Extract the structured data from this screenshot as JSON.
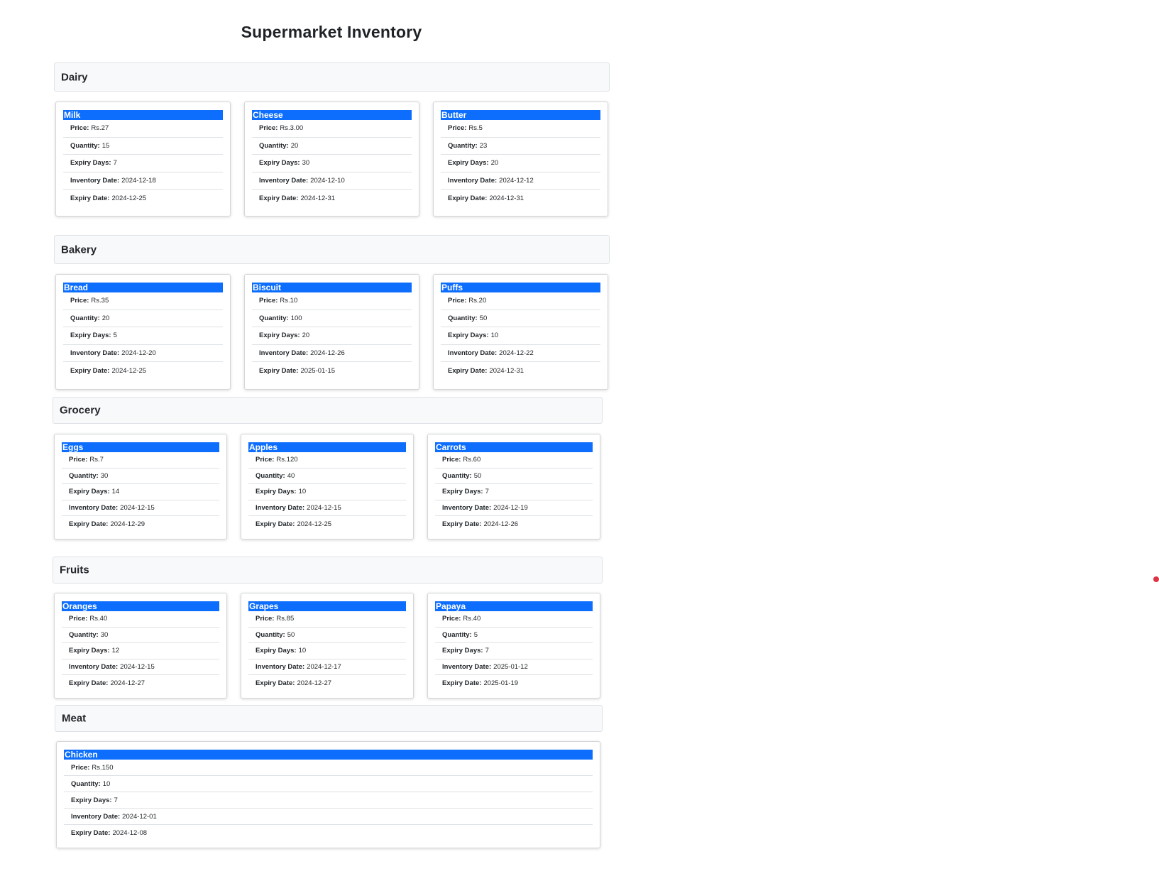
{
  "page": {
    "title": "Supermarket Inventory"
  },
  "fields": {
    "price": "Price:",
    "quantity": "Quantity:",
    "expiry_days": "Expiry Days:",
    "inventory_date": "Inventory Date:",
    "expiry_date": "Expiry Date:"
  },
  "categories": [
    {
      "name": "Dairy",
      "products": [
        {
          "name": "Milk",
          "price": "Rs.27",
          "quantity": "15",
          "expiry_days": "7",
          "inventory_date": "2024-12-18",
          "expiry_date": "2024-12-25"
        },
        {
          "name": "Cheese",
          "price": "Rs.3.00",
          "quantity": "20",
          "expiry_days": "30",
          "inventory_date": "2024-12-10",
          "expiry_date": "2024-12-31"
        },
        {
          "name": "Butter",
          "price": "Rs.5",
          "quantity": "23",
          "expiry_days": "20",
          "inventory_date": "2024-12-12",
          "expiry_date": "2024-12-31"
        }
      ]
    },
    {
      "name": "Bakery",
      "products": [
        {
          "name": "Bread",
          "price": "Rs.35",
          "quantity": "20",
          "expiry_days": "5",
          "inventory_date": "2024-12-20",
          "expiry_date": "2024-12-25"
        },
        {
          "name": "Biscuit",
          "price": "Rs.10",
          "quantity": "100",
          "expiry_days": "20",
          "inventory_date": "2024-12-26",
          "expiry_date": "2025-01-15"
        },
        {
          "name": "Puffs",
          "price": "Rs.20",
          "quantity": "50",
          "expiry_days": "10",
          "inventory_date": "2024-12-22",
          "expiry_date": "2024-12-31"
        }
      ]
    },
    {
      "name": "Grocery",
      "products": [
        {
          "name": "Eggs",
          "price": "Rs.7",
          "quantity": "30",
          "expiry_days": "14",
          "inventory_date": "2024-12-15",
          "expiry_date": "2024-12-29"
        },
        {
          "name": "Apples",
          "price": "Rs.120",
          "quantity": "40",
          "expiry_days": "10",
          "inventory_date": "2024-12-15",
          "expiry_date": "2024-12-25"
        },
        {
          "name": "Carrots",
          "price": "Rs.60",
          "quantity": "50",
          "expiry_days": "7",
          "inventory_date": "2024-12-19",
          "expiry_date": "2024-12-26"
        }
      ]
    },
    {
      "name": "Fruits",
      "products": [
        {
          "name": "Oranges",
          "price": "Rs.40",
          "quantity": "30",
          "expiry_days": "12",
          "inventory_date": "2024-12-15",
          "expiry_date": "2024-12-27"
        },
        {
          "name": "Grapes",
          "price": "Rs.85",
          "quantity": "50",
          "expiry_days": "10",
          "inventory_date": "2024-12-17",
          "expiry_date": "2024-12-27"
        },
        {
          "name": "Papaya",
          "price": "Rs.40",
          "quantity": "5",
          "expiry_days": "7",
          "inventory_date": "2025-01-12",
          "expiry_date": "2025-01-19"
        }
      ]
    },
    {
      "name": "Meat",
      "products": [
        {
          "name": "Chicken",
          "price": "Rs.150",
          "quantity": "10",
          "expiry_days": "7",
          "inventory_date": "2024-12-01",
          "expiry_date": "2024-12-08"
        }
      ]
    }
  ],
  "colors": {
    "accent": "#0d6efd",
    "header_bg": "#f8f9fa",
    "indicator": "#dc3545"
  }
}
